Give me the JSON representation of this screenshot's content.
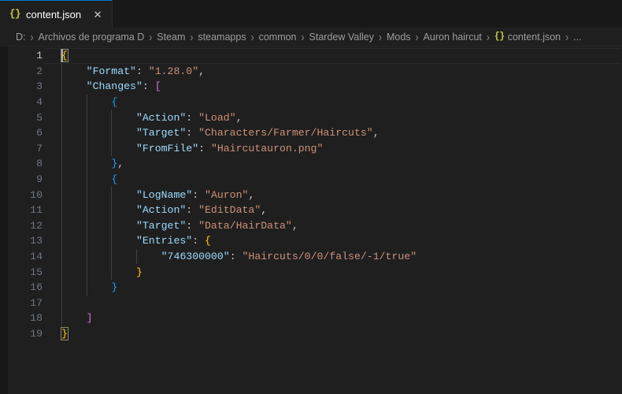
{
  "window": {
    "app": "Visual Studio Code",
    "theme_bg": "#1f1f1f"
  },
  "tabbar": {
    "tabs": [
      {
        "icon": "json-braces-icon",
        "icon_glyph": "{}",
        "label": "content.json",
        "close_glyph": "✕",
        "active": true
      }
    ]
  },
  "breadcrumbs": {
    "separator": "›",
    "items": [
      {
        "label": "D:",
        "icon": null
      },
      {
        "label": "Archivos de programa D",
        "icon": null
      },
      {
        "label": "Steam",
        "icon": null
      },
      {
        "label": "steamapps",
        "icon": null
      },
      {
        "label": "common",
        "icon": null
      },
      {
        "label": "Stardew Valley",
        "icon": null
      },
      {
        "label": "Mods",
        "icon": null
      },
      {
        "label": "Auron haircut",
        "icon": null
      },
      {
        "label": "content.json",
        "icon": "{}"
      },
      {
        "label": "...",
        "icon": null
      }
    ]
  },
  "editor": {
    "language": "json",
    "active_line": 1,
    "total_lines": 19,
    "lines": [
      {
        "n": "1",
        "tokens": [
          {
            "t": "{",
            "c": "b0",
            "match": true
          }
        ]
      },
      {
        "n": "2",
        "tokens": [
          {
            "t": "    ",
            "c": "p"
          },
          {
            "t": "\"Format\"",
            "c": "k"
          },
          {
            "t": ": ",
            "c": "p"
          },
          {
            "t": "\"1.28.0\"",
            "c": "s"
          },
          {
            "t": ",",
            "c": "p"
          }
        ]
      },
      {
        "n": "3",
        "tokens": [
          {
            "t": "    ",
            "c": "p"
          },
          {
            "t": "\"Changes\"",
            "c": "k"
          },
          {
            "t": ": ",
            "c": "p"
          },
          {
            "t": "[",
            "c": "b1"
          }
        ]
      },
      {
        "n": "4",
        "tokens": [
          {
            "t": "        ",
            "c": "p"
          },
          {
            "t": "{",
            "c": "b2"
          }
        ]
      },
      {
        "n": "5",
        "tokens": [
          {
            "t": "            ",
            "c": "p"
          },
          {
            "t": "\"Action\"",
            "c": "k"
          },
          {
            "t": ": ",
            "c": "p"
          },
          {
            "t": "\"Load\"",
            "c": "s"
          },
          {
            "t": ",",
            "c": "p"
          }
        ]
      },
      {
        "n": "6",
        "tokens": [
          {
            "t": "            ",
            "c": "p"
          },
          {
            "t": "\"Target\"",
            "c": "k"
          },
          {
            "t": ": ",
            "c": "p"
          },
          {
            "t": "\"Characters/Farmer/Haircuts\"",
            "c": "s"
          },
          {
            "t": ",",
            "c": "p"
          }
        ]
      },
      {
        "n": "7",
        "tokens": [
          {
            "t": "            ",
            "c": "p"
          },
          {
            "t": "\"FromFile\"",
            "c": "k"
          },
          {
            "t": ": ",
            "c": "p"
          },
          {
            "t": "\"Haircutauron.png\"",
            "c": "s"
          }
        ]
      },
      {
        "n": "8",
        "tokens": [
          {
            "t": "        ",
            "c": "p"
          },
          {
            "t": "}",
            "c": "b2"
          },
          {
            "t": ",",
            "c": "p"
          }
        ]
      },
      {
        "n": "9",
        "tokens": [
          {
            "t": "        ",
            "c": "p"
          },
          {
            "t": "{",
            "c": "b2"
          }
        ]
      },
      {
        "n": "10",
        "tokens": [
          {
            "t": "            ",
            "c": "p"
          },
          {
            "t": "\"LogName\"",
            "c": "k"
          },
          {
            "t": ": ",
            "c": "p"
          },
          {
            "t": "\"Auron\"",
            "c": "s"
          },
          {
            "t": ",",
            "c": "p"
          }
        ]
      },
      {
        "n": "11",
        "tokens": [
          {
            "t": "            ",
            "c": "p"
          },
          {
            "t": "\"Action\"",
            "c": "k"
          },
          {
            "t": ": ",
            "c": "p"
          },
          {
            "t": "\"EditData\"",
            "c": "s"
          },
          {
            "t": ",",
            "c": "p"
          }
        ]
      },
      {
        "n": "12",
        "tokens": [
          {
            "t": "            ",
            "c": "p"
          },
          {
            "t": "\"Target\"",
            "c": "k"
          },
          {
            "t": ": ",
            "c": "p"
          },
          {
            "t": "\"Data/HairData\"",
            "c": "s"
          },
          {
            "t": ",",
            "c": "p"
          }
        ]
      },
      {
        "n": "13",
        "tokens": [
          {
            "t": "            ",
            "c": "p"
          },
          {
            "t": "\"Entries\"",
            "c": "k"
          },
          {
            "t": ": ",
            "c": "p"
          },
          {
            "t": "{",
            "c": "b0"
          }
        ]
      },
      {
        "n": "14",
        "tokens": [
          {
            "t": "                ",
            "c": "p"
          },
          {
            "t": "\"746300000\"",
            "c": "k"
          },
          {
            "t": ": ",
            "c": "p"
          },
          {
            "t": "\"Haircuts/0/0/false/-1/true\"",
            "c": "s"
          }
        ]
      },
      {
        "n": "15",
        "tokens": [
          {
            "t": "            ",
            "c": "p"
          },
          {
            "t": "}",
            "c": "b0"
          }
        ]
      },
      {
        "n": "16",
        "tokens": [
          {
            "t": "        ",
            "c": "p"
          },
          {
            "t": "}",
            "c": "b2"
          }
        ]
      },
      {
        "n": "17",
        "tokens": []
      },
      {
        "n": "18",
        "tokens": [
          {
            "t": "    ",
            "c": "p"
          },
          {
            "t": "]",
            "c": "b1"
          }
        ]
      },
      {
        "n": "19",
        "tokens": [
          {
            "t": "}",
            "c": "b0",
            "match": true
          }
        ]
      }
    ]
  }
}
